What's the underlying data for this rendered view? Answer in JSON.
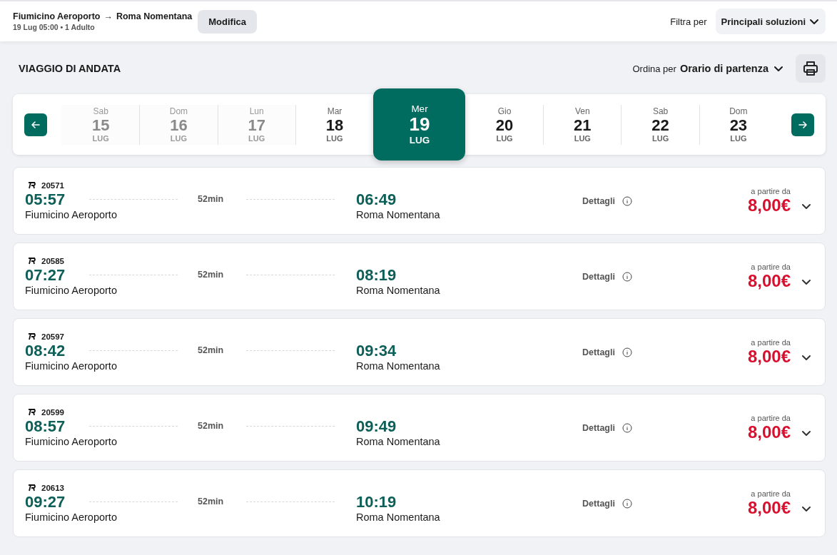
{
  "header": {
    "route_from": "Fiumicino Aeroporto",
    "route_to": "Roma Nomentana",
    "arrow": "→",
    "subtitle": "19 Lug 05:00 • 1 Adulto",
    "edit_button": "Modifica",
    "filter_label": "Filtra per",
    "filter_value": "Principali soluzioni"
  },
  "section": {
    "title": "VIAGGIO DI ANDATA",
    "sort_label": "Ordina per",
    "sort_value": "Orario di partenza"
  },
  "dates": [
    {
      "weekday": "Sab",
      "day": "15",
      "month": "LUG",
      "selected": false,
      "disabled": true
    },
    {
      "weekday": "Dom",
      "day": "16",
      "month": "LUG",
      "selected": false,
      "disabled": true
    },
    {
      "weekday": "Lun",
      "day": "17",
      "month": "LUG",
      "selected": false,
      "disabled": true
    },
    {
      "weekday": "Mar",
      "day": "18",
      "month": "LUG",
      "selected": false,
      "disabled": false
    },
    {
      "weekday": "Mer",
      "day": "19",
      "month": "LUG",
      "selected": true,
      "disabled": false
    },
    {
      "weekday": "Gio",
      "day": "20",
      "month": "LUG",
      "selected": false,
      "disabled": false
    },
    {
      "weekday": "Ven",
      "day": "21",
      "month": "LUG",
      "selected": false,
      "disabled": false
    },
    {
      "weekday": "Sab",
      "day": "22",
      "month": "LUG",
      "selected": false,
      "disabled": false
    },
    {
      "weekday": "Dom",
      "day": "23",
      "month": "LUG",
      "selected": false,
      "disabled": false
    }
  ],
  "trains": [
    {
      "number": "20571",
      "departure_time": "05:57",
      "departure_station": "Fiumicino Aeroporto",
      "duration": "52min",
      "arrival_time": "06:49",
      "arrival_station": "Roma Nomentana",
      "details": "Dettagli",
      "price_label": "a partire da",
      "price": "8,00€"
    },
    {
      "number": "20585",
      "departure_time": "07:27",
      "departure_station": "Fiumicino Aeroporto",
      "duration": "52min",
      "arrival_time": "08:19",
      "arrival_station": "Roma Nomentana",
      "details": "Dettagli",
      "price_label": "a partire da",
      "price": "8,00€"
    },
    {
      "number": "20597",
      "departure_time": "08:42",
      "departure_station": "Fiumicino Aeroporto",
      "duration": "52min",
      "arrival_time": "09:34",
      "arrival_station": "Roma Nomentana",
      "details": "Dettagli",
      "price_label": "a partire da",
      "price": "8,00€"
    },
    {
      "number": "20599",
      "departure_time": "08:57",
      "departure_station": "Fiumicino Aeroporto",
      "duration": "52min",
      "arrival_time": "09:49",
      "arrival_station": "Roma Nomentana",
      "details": "Dettagli",
      "price_label": "a partire da",
      "price": "8,00€"
    },
    {
      "number": "20613",
      "departure_time": "09:27",
      "departure_station": "Fiumicino Aeroporto",
      "duration": "52min",
      "arrival_time": "10:19",
      "arrival_station": "Roma Nomentana",
      "details": "Dettagli",
      "price_label": "a partire da",
      "price": "8,00€"
    }
  ]
}
